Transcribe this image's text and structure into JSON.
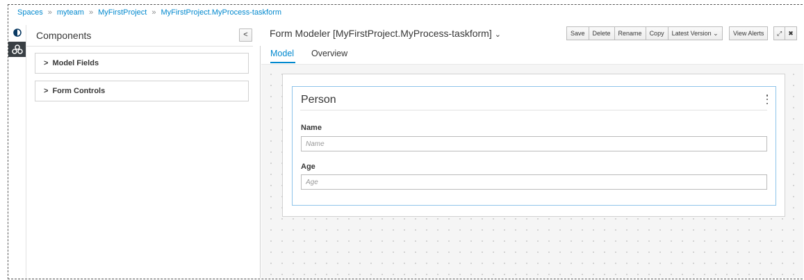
{
  "breadcrumb": {
    "items": [
      "Spaces",
      "myteam",
      "MyFirstProject",
      "MyFirstProject.MyProcess-taskform"
    ],
    "separator": "»"
  },
  "strip": {
    "icons": [
      "contrast-icon",
      "components-icon"
    ]
  },
  "components": {
    "title": "Components",
    "collapse_glyph": "<",
    "sections": [
      {
        "chevron": ">",
        "label": "Model Fields"
      },
      {
        "chevron": ">",
        "label": "Form Controls"
      }
    ]
  },
  "editor": {
    "title": "Form Modeler [MyFirstProject.MyProcess-taskform]",
    "title_caret": "⌄",
    "toolbar": {
      "save": "Save",
      "delete": "Delete",
      "rename": "Rename",
      "copy": "Copy",
      "latest_version": "Latest Version",
      "latest_caret": "⌄",
      "view_alerts": "View Alerts",
      "maximize": "⤢",
      "close": "✖"
    },
    "tabs": [
      {
        "label": "Model",
        "active": true
      },
      {
        "label": "Overview",
        "active": false
      }
    ]
  },
  "form": {
    "title": "Person",
    "fields": [
      {
        "label": "Name",
        "placeholder": "Name",
        "value": ""
      },
      {
        "label": "Age",
        "placeholder": "Age",
        "value": ""
      }
    ]
  },
  "colors": {
    "accent": "#0088ce",
    "strip_active": "#393f44"
  }
}
